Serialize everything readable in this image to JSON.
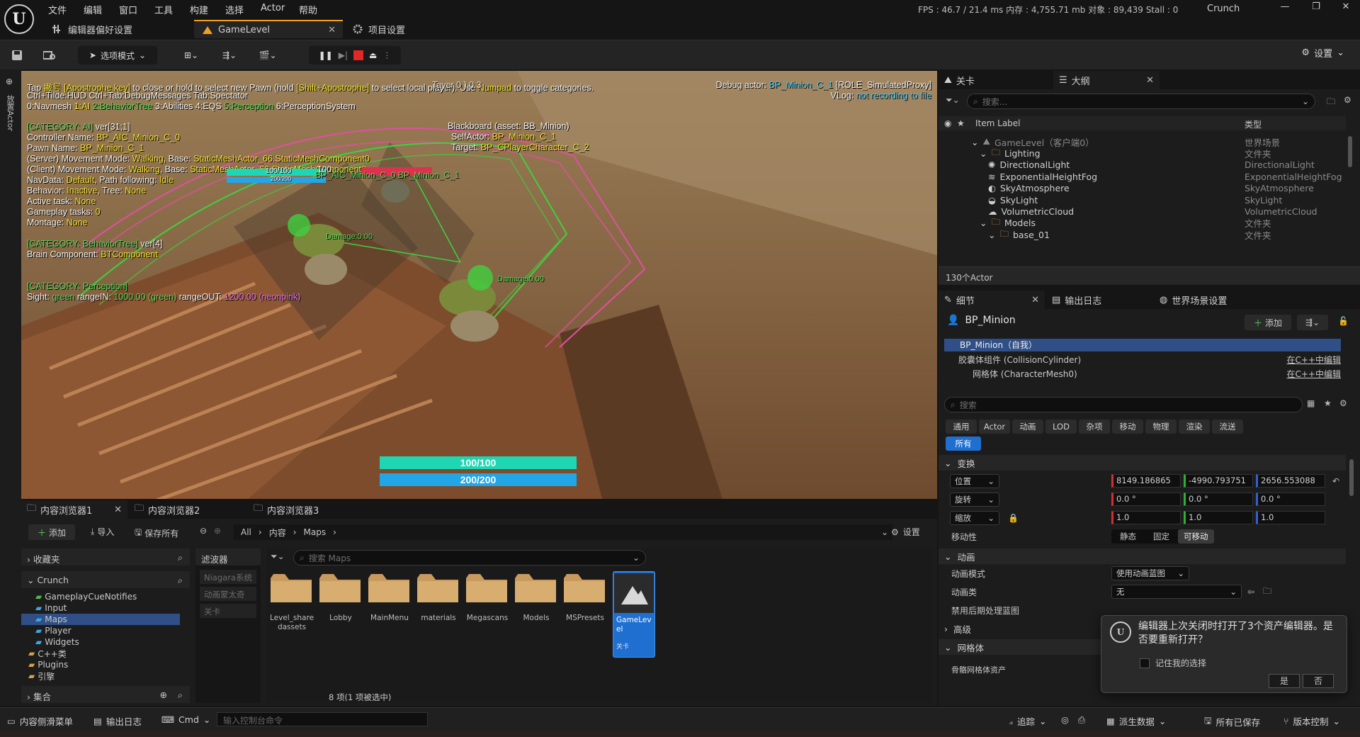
{
  "menu": [
    "文件",
    "编辑",
    "窗口",
    "工具",
    "构建",
    "选择",
    "Actor",
    "帮助"
  ],
  "perf": {
    "fps_label": "FPS : ",
    "fps": "46.7",
    "ms": " / 21.4 ms ",
    "mem_label": "内存 : ",
    "mem": "4,755.71 mb",
    "obj_label": " 对象 : ",
    "obj": "89,439",
    "stall_label": " Stall : ",
    "stall": "0"
  },
  "project_name": "Crunch",
  "doc_tabs": [
    "编辑器偏好设置",
    "GameLevel",
    "项目设置"
  ],
  "toolbar": {
    "mode_label": "选项模式",
    "settings_label": "设置"
  },
  "left_strip_label": "放置Actor",
  "viewport": {
    "line1a": "Tap ",
    "line1b": "撇号 [Apostrophe key]",
    "line1c": " to close or hold to select new Pawn (hold ",
    "line1d": "[Shift+Apostrophe]",
    "line1e": " to select local player). Use ",
    "line1f": "Numpad",
    "line1g": " to toggle categories.",
    "line1_overlap": "Tayer 0 ) 0 3",
    "line2": "Ctrl+Tilde:HUD  Ctrl+Tab:DebugMessages  Tab:Spectator",
    "line3": [
      "0:Navmesh",
      "1:AI",
      "2:BehaviorTree",
      "3:Abilities",
      "4:EQS",
      "5:Perception",
      "6:PerceptionSystem"
    ],
    "debug_actor_label": "Debug actor: ",
    "debug_actor": "BP_Minion_C_1",
    "debug_actor_role": " [ROLE_SimulatedProxy]",
    "vlog_label": "VLog: ",
    "vlog": "not recording to file",
    "ai_header": "[CATEGORY: AI]",
    "ai_ver": " ver[31;1]",
    "controller_label": "Controller Name: ",
    "controller": "BP_AIC_Minion_C_0",
    "pawn_label": "Pawn Name: ",
    "pawn": "BP_Minion_C_1",
    "server_move_label": "(Server) Movement Mode: ",
    "server_move": "Walking",
    "server_base_label": ", Base: ",
    "server_base": "StaticMeshActor_66.StaticMeshComponent0",
    "client_move_label": "(Client) Movement Mode: ",
    "client_move": "Walking",
    "client_base_label": ", Base: ",
    "client_base": "StaticMeshActor_66.StaticMeshComponent0",
    "navdata_label": "NavData: ",
    "navdata": "Default",
    "path_label": ", Path following: ",
    "path": "Idle",
    "behavior_label": "Behavior: ",
    "behavior": "Inactive",
    "tree_label": ", Tree: ",
    "tree": "None",
    "active_task_label": "Active task: ",
    "active_task": "None",
    "gameplay_tasks_label": "Gameplay tasks: ",
    "gameplay_tasks": "0",
    "montage_label": "Montage: ",
    "montage": "None",
    "bt_header": "[CATEGORY: BehaviorTree]",
    "bt_ver": " ver[4]",
    "brain_label": "Brain Component: ",
    "brain": "BTComponent",
    "perception_header": "[CATEGORY: Perception]",
    "sight_label": "Sight: ",
    "sight": "green",
    "range_in_label": " rangeIN: ",
    "range_in": "1000.00 (green)",
    "range_out_label": "  rangeOUT: ",
    "range_out": "1200.00 (neonpink)",
    "bb_title": "Blackboard (asset: BB_Minion)",
    "bb_self_label": "SelfActor: ",
    "bb_self": "BP_Minion_C_1",
    "bb_target_label": "Target: ",
    "bb_target": "BP_CPlayerCharacter_C_2",
    "overhead_hp": "100/100",
    "overhead_mp": "200/200",
    "overhead_name": "BP_AIC_Minion_C_0  BP_Minion_C_1",
    "overhead_extra": "100",
    "damage_a": "Damage:0.00",
    "damage_b": "Damage:0.00",
    "hp_bar": "100/100",
    "mp_bar": "200/200",
    "hp_fraction": 1.0,
    "mp_fraction": 1.0
  },
  "outliner": {
    "tab_level": "关卡",
    "tab_outliner": "大纲",
    "search_placeholder": "搜索...",
    "col_label": "Item Label",
    "col_type": "类型",
    "rows": [
      {
        "label": "GameLevel（客户端0）",
        "type": "世界场景",
        "indent": 0,
        "icon": "level"
      },
      {
        "label": "Lighting",
        "type": "文件夹",
        "indent": 1,
        "icon": "folder"
      },
      {
        "label": "DirectionalLight",
        "type": "DirectionalLight",
        "indent": 2,
        "icon": "light"
      },
      {
        "label": "ExponentialHeightFog",
        "type": "ExponentialHeightFog",
        "indent": 2,
        "icon": "fog"
      },
      {
        "label": "SkyAtmosphere",
        "type": "SkyAtmosphere",
        "indent": 2,
        "icon": "sky"
      },
      {
        "label": "SkyLight",
        "type": "SkyLight",
        "indent": 2,
        "icon": "skylight"
      },
      {
        "label": "VolumetricCloud",
        "type": "VolumetricCloud",
        "indent": 2,
        "icon": "cloud"
      },
      {
        "label": "Models",
        "type": "文件夹",
        "indent": 1,
        "icon": "folder"
      },
      {
        "label": "base_01",
        "type": "文件夹",
        "indent": 2,
        "icon": "folder"
      }
    ],
    "actor_count": "130个Actor"
  },
  "details": {
    "tab_details": "细节",
    "tab_output": "输出日志",
    "tab_world": "世界场景设置",
    "actor_name": "BP_Minion",
    "add_label": "添加",
    "components": [
      {
        "label": "BP_Minion（自我）",
        "edit": ""
      },
      {
        "label": "胶囊体组件 (CollisionCylinder)",
        "edit": "在C++中编辑"
      },
      {
        "label": "网格体 (CharacterMesh0)",
        "edit": "在C++中编辑"
      }
    ],
    "search_placeholder": "搜索",
    "categories": [
      "通用",
      "Actor",
      "动画",
      "LOD",
      "杂项",
      "移动",
      "物理",
      "渲染",
      "流送"
    ],
    "all_label": "所有",
    "transform_section": "变换",
    "location_label": "位置",
    "location": [
      "8149.186865",
      "-4990.793751",
      "2656.553088"
    ],
    "rotation_label": "旋转",
    "rotation": [
      "0.0 °",
      "0.0 °",
      "0.0 °"
    ],
    "scale_label": "缩放",
    "scale": [
      "1.0",
      "1.0",
      "1.0"
    ],
    "mobility_label": "移动性",
    "mobility": [
      "静态",
      "固定",
      "可移动"
    ],
    "anim_section": "动画",
    "anim_mode_label": "动画模式",
    "anim_mode": "使用动画蓝图",
    "anim_class_label": "动画类",
    "anim_class": "无",
    "disable_post_label": "禁用后期处理蓝图",
    "advanced_section": "高级",
    "mesh_section": "网格体",
    "skeletal_label": "骨骼网格体资产"
  },
  "content_browser": {
    "tabs": [
      "内容浏览器1",
      "内容浏览器2",
      "内容浏览器3"
    ],
    "add_label": "添加",
    "import_label": "导入",
    "save_all_label": "保存所有",
    "path": [
      "All",
      "内容",
      "Maps"
    ],
    "settings_label": "设置",
    "favorites_label": "收藏夹",
    "project_label": "Crunch",
    "tree": [
      "GameplayCueNotifies",
      "Input",
      "Maps",
      "Player",
      "Widgets",
      "C++类",
      "Plugins",
      "引擎"
    ],
    "collections_label": "集合",
    "filter_header": "滤波器",
    "filters": [
      "Niagara系统",
      "动画蒙太奇",
      "关卡"
    ],
    "search_placeholder": "搜索 Maps",
    "assets": [
      {
        "name": "Level_sharedassets",
        "kind": "folder"
      },
      {
        "name": "Lobby",
        "kind": "folder"
      },
      {
        "name": "MainMenu",
        "kind": "folder"
      },
      {
        "name": "materials",
        "kind": "folder"
      },
      {
        "name": "Megascans",
        "kind": "folder"
      },
      {
        "name": "Models",
        "kind": "folder"
      },
      {
        "name": "MSPresets",
        "kind": "folder"
      },
      {
        "name": "GameLevel",
        "kind": "level",
        "sub": "关卡"
      }
    ],
    "status": "8 项(1 项被选中)"
  },
  "statusbar": {
    "drawer": "内容侧滑菜单",
    "output": "输出日志",
    "cmd": "Cmd",
    "console_placeholder": "输入控制台命令",
    "trace": "追踪",
    "derived": "派生数据",
    "saved": "所有已保存",
    "source_control": "版本控制"
  },
  "notification": {
    "message": "编辑器上次关闭时打开了3个资产编辑器。是否要重新打开？",
    "remember": "记住我的选择",
    "yes": "是",
    "no": "否"
  },
  "colors": {
    "accent_orange": "#f0a020",
    "selection_blue": "#1f6fd1",
    "hp_teal": "#1fd6b4",
    "mp_blue": "#22a6e6"
  }
}
